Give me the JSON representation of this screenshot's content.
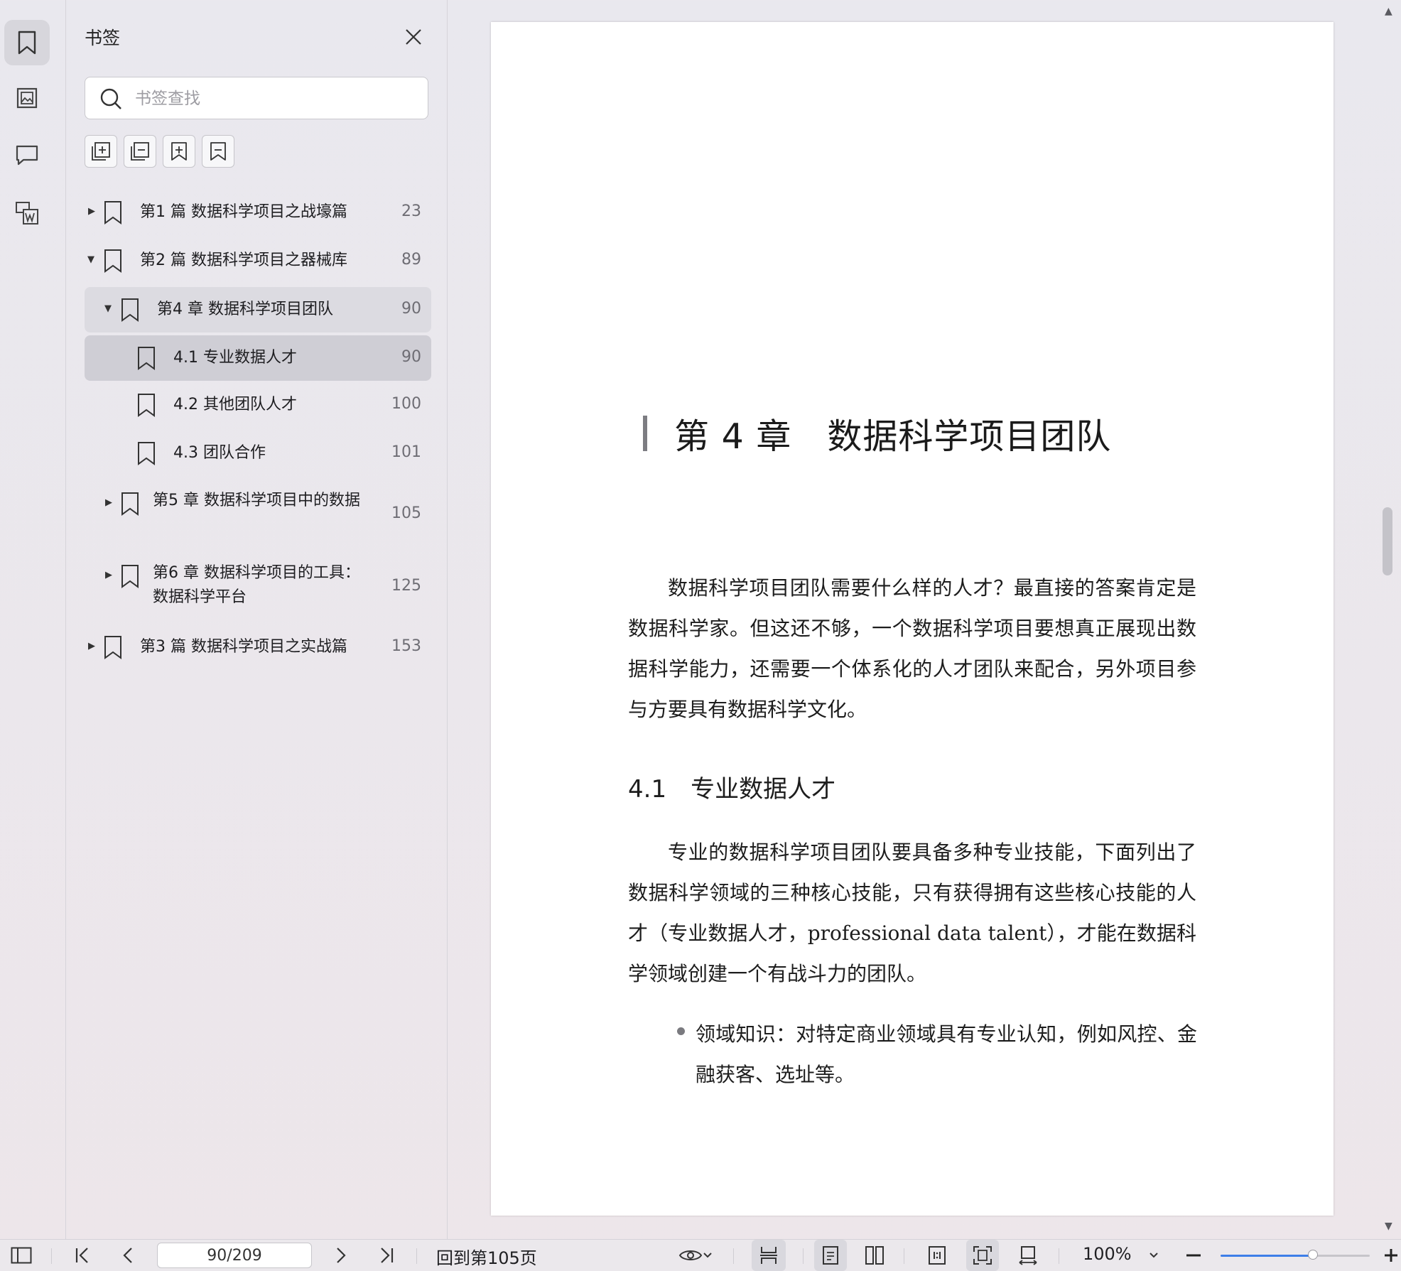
{
  "panel": {
    "title": "书签",
    "search_placeholder": "书签查找"
  },
  "rail": {
    "items": [
      {
        "icon": "bookmark-icon",
        "active": true
      },
      {
        "icon": "thumbnail-icon",
        "active": false
      },
      {
        "icon": "comment-icon",
        "active": false
      },
      {
        "icon": "convert-icon",
        "active": false
      }
    ]
  },
  "bookmarks": [
    {
      "label": "第1 篇 数据科学项目之战壕篇",
      "page": "23",
      "level": 0,
      "expanded": false,
      "has_children": true
    },
    {
      "label": "第2 篇 数据科学项目之器械库",
      "page": "89",
      "level": 0,
      "expanded": true,
      "has_children": true
    },
    {
      "label": "第4 章 数据科学项目团队",
      "page": "90",
      "level": 1,
      "expanded": true,
      "has_children": true,
      "highlight": "light"
    },
    {
      "label": "4.1 专业数据人才",
      "page": "90",
      "level": 2,
      "has_children": false,
      "highlight": "selected"
    },
    {
      "label": "4.2 其他团队人才",
      "page": "100",
      "level": 2,
      "has_children": false
    },
    {
      "label": "4.3 团队合作",
      "page": "101",
      "level": 2,
      "has_children": false
    },
    {
      "label": "第5 章 数据科学项目中的数据",
      "page": "105",
      "level": 1,
      "expanded": false,
      "has_children": true
    },
    {
      "label": "第6 章 数据科学项目的工具：数据科学平台",
      "page": "125",
      "level": 1,
      "expanded": false,
      "has_children": true
    },
    {
      "label": "第3 篇 数据科学项目之实战篇",
      "page": "153",
      "level": 0,
      "expanded": false,
      "has_children": true
    }
  ],
  "document": {
    "chapter_title": "第 4 章　数据科学项目团队",
    "intro": "数据科学项目团队需要什么样的人才？最直接的答案肯定是数据科学家。但这还不够，一个数据科学项目要想真正展现出数据科学能力，还需要一个体系化的人才团队来配合，另外项目参与方要具有数据科学文化。",
    "section_title": "4.1　专业数据人才",
    "section_para": "专业的数据科学项目团队要具备多种专业技能，下面列出了数据科学领域的三种核心技能，只有获得拥有这些核心技能的人才（专业数据人才，professional data talent），才能在数据科学领域创建一个有战斗力的团队。",
    "bullet": "领域知识：对特定商业领域具有专业认知，例如风控、金融获客、选址等。"
  },
  "statusbar": {
    "page_value": "90/209",
    "back_link": "回到第105页",
    "zoom": "100%",
    "zoom_level": 0.62
  },
  "colors": {
    "accent": "#3d7ee8",
    "selected_row": "#cfced5",
    "highlight_row": "#dcdbe1"
  }
}
